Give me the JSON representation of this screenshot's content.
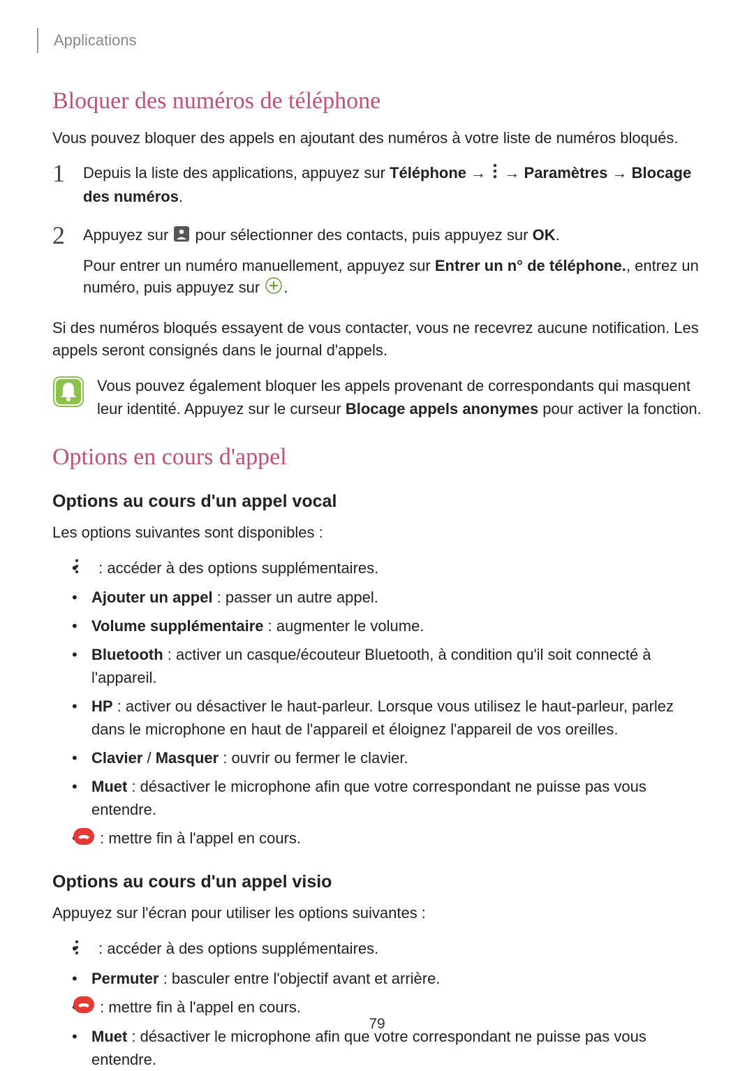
{
  "header": {
    "breadcrumb": "Applications"
  },
  "section1": {
    "heading": "Bloquer des numéros de téléphone",
    "intro": "Vous pouvez bloquer des appels en ajoutant des numéros à votre liste de numéros bloqués.",
    "step1": {
      "num": "1",
      "pre": "Depuis la liste des applications, appuyez sur ",
      "b1": "Téléphone",
      "arrow1": " → ",
      "arrow2": " → ",
      "b2": "Paramètres",
      "arrow3": " → ",
      "b3": "Blocage des numéros",
      "post": "."
    },
    "step2": {
      "num": "2",
      "line1_pre": "Appuyez sur ",
      "line1_post": " pour sélectionner des contacts, puis appuyez sur ",
      "line1_b": "OK",
      "line1_end": ".",
      "line2_pre": "Pour entrer un numéro manuellement, appuyez sur ",
      "line2_b": "Entrer un n° de téléphone.",
      "line2_mid": ", entrez un numéro, puis appuyez sur ",
      "line2_end": "."
    },
    "after": "Si des numéros bloqués essayent de vous contacter, vous ne recevrez aucune notification. Les appels seront consignés dans le journal d'appels.",
    "note_pre": "Vous pouvez également bloquer les appels provenant de correspondants qui masquent leur identité. Appuyez sur le curseur ",
    "note_b": "Blocage appels anonymes",
    "note_post": " pour activer la fonction."
  },
  "section2": {
    "heading": "Options en cours d'appel",
    "sub1": {
      "heading": "Options au cours d'un appel vocal",
      "intro": "Les options suivantes sont disponibles :",
      "items": {
        "i0_post": " : accéder à des options supplémentaires.",
        "i1_b": "Ajouter un appel",
        "i1_post": " : passer un autre appel.",
        "i2_b": "Volume supplémentaire",
        "i2_post": " : augmenter le volume.",
        "i3_b": "Bluetooth",
        "i3_post": " : activer un casque/écouteur Bluetooth, à condition qu'il soit connecté à l'appareil.",
        "i4_b": "HP",
        "i4_post": " : activer ou désactiver le haut-parleur. Lorsque vous utilisez le haut-parleur, parlez dans le microphone en haut de l'appareil et éloignez l'appareil de vos oreilles.",
        "i5_b1": "Clavier",
        "i5_sep": " / ",
        "i5_b2": "Masquer",
        "i5_post": " : ouvrir ou fermer le clavier.",
        "i6_b": "Muet",
        "i6_post": " : désactiver le microphone afin que votre correspondant ne puisse pas vous entendre.",
        "i7_post": " : mettre fin à l'appel en cours."
      }
    },
    "sub2": {
      "heading": "Options au cours d'un appel visio",
      "intro": "Appuyez sur l'écran pour utiliser les options suivantes :",
      "items": {
        "i0_post": " : accéder à des options supplémentaires.",
        "i1_b": "Permuter",
        "i1_post": " : basculer entre l'objectif avant et arrière.",
        "i2_post": " : mettre fin à l'appel en cours.",
        "i3_b": "Muet",
        "i3_post": " : désactiver le microphone afin que votre correspondant ne puisse pas vous entendre."
      }
    }
  },
  "page_number": "79",
  "icons": {
    "more": "more-vert-icon",
    "contact": "contact-icon",
    "plus": "plus-circle-icon",
    "bell": "bell-note-icon",
    "endcall": "end-call-icon"
  }
}
